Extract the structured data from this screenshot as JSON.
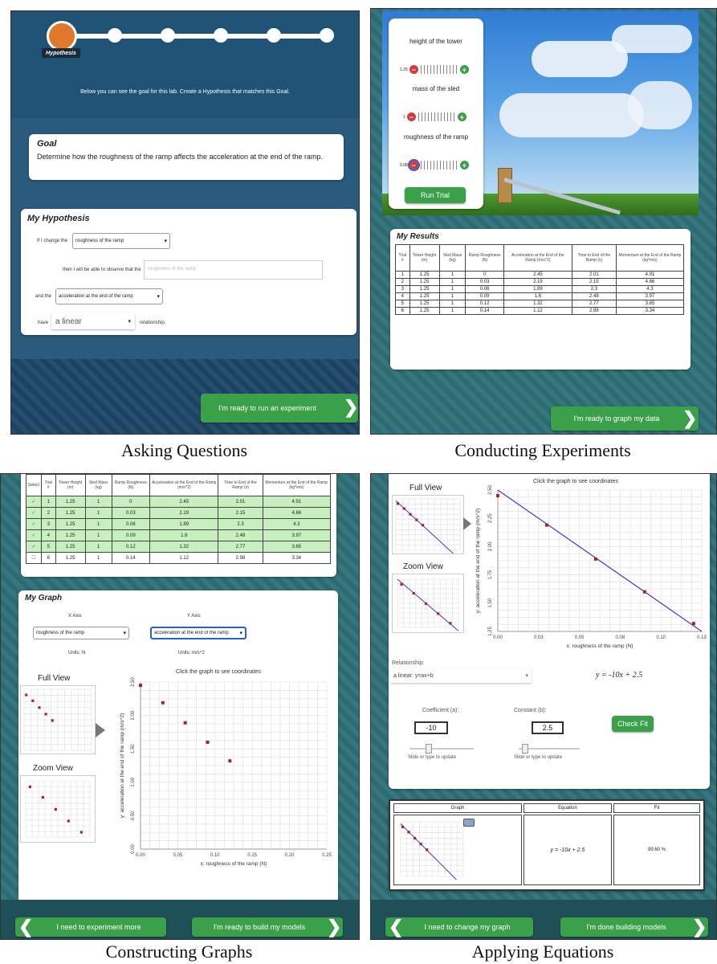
{
  "captions": {
    "q1": "Asking Questions",
    "q2": "Conducting Experiments",
    "q3": "Constructing Graphs",
    "q4": "Applying Equations"
  },
  "colors": {
    "teal": "#2d6f76",
    "navy": "#1e4a6b",
    "green": "#3aa04a",
    "red": "#d63b3b",
    "blue_line": "#3b3bd6",
    "point": "#b02020"
  },
  "asking": {
    "step_label": "Hypothesis",
    "intro": "Below you can see the goal for this lab. Create a Hypothesis that matches this Goal.",
    "goal_title": "Goal",
    "goal_text": "Determine how the roughness of the ramp affects the acceleration at the end of the ramp.",
    "hyp_title": "My Hypothesis",
    "if_change": "If I change the",
    "var1": "roughness of the ramp",
    "then_text": "then I will be able to observe that the",
    "then_placeholder": "roughness of the ramp",
    "and_the": "and the",
    "var2": "acceleration at the end of the ramp",
    "have": "have",
    "relationship": "a linear",
    "relationship_suffix": "relationship.",
    "next_button": "I'm ready to run an experiment"
  },
  "experiment": {
    "controls": [
      {
        "label": "height of the tower",
        "value": "1.25"
      },
      {
        "label": "mass of the sled",
        "value": "1"
      },
      {
        "label": "roughness of the ramp",
        "value": "0.08"
      }
    ],
    "run_button": "Run Trial",
    "results_title": "My Results",
    "headers": [
      "Trial #",
      "Tower Height (m)",
      "Sled Mass (kg)",
      "Ramp Roughness (N)",
      "Acceleration at the End of the Ramp (m/s^2)",
      "Time to End of the Ramp (s)",
      "Momentum at the End of the Ramp (kg*m/s)"
    ],
    "rows": [
      [
        "1",
        "1.25",
        "1",
        "0",
        "2.45",
        "2.01",
        "4.91"
      ],
      [
        "2",
        "1.25",
        "1",
        "0.03",
        "2.19",
        "2.15",
        "4.66"
      ],
      [
        "3",
        "1.25",
        "1",
        "0.06",
        "1.89",
        "2.3",
        "4.3"
      ],
      [
        "4",
        "1.25",
        "1",
        "0.09",
        "1.6",
        "2.48",
        "3.97"
      ],
      [
        "5",
        "1.25",
        "1",
        "0.12",
        "1.32",
        "2.77",
        "3.65"
      ],
      [
        "6",
        "1.25",
        "1",
        "0.14",
        "1.12",
        "2.98",
        "3.34"
      ]
    ],
    "next_button": "I'm ready to graph my data"
  },
  "graphs": {
    "headers": [
      "Select",
      "Trial #",
      "Tower Height (m)",
      "Sled Mass (kg)",
      "Ramp Roughness (N)",
      "Acceleration at the End of the Ramp (m/s^2)",
      "Time to End of the Ramp (s)",
      "Momentum at the End of the Ramp (kg*m/s)"
    ],
    "rows": [
      [
        "✓",
        "1",
        "1.25",
        "1",
        "0",
        "2.45",
        "2.01",
        "4.91"
      ],
      [
        "✓",
        "2",
        "1.25",
        "1",
        "0.03",
        "2.19",
        "2.15",
        "4.66"
      ],
      [
        "✓",
        "3",
        "1.25",
        "1",
        "0.06",
        "1.89",
        "2.3",
        "4.3"
      ],
      [
        "✓",
        "4",
        "1.25",
        "1",
        "0.09",
        "1.6",
        "2.48",
        "3.97"
      ],
      [
        "✓",
        "5",
        "1.25",
        "1",
        "0.12",
        "1.32",
        "2.77",
        "3.65"
      ],
      [
        "☐",
        "6",
        "1.25",
        "1",
        "0.14",
        "1.12",
        "2.98",
        "3.34"
      ]
    ],
    "graph_title": "My Graph",
    "x_axis_label": "X Axis",
    "y_axis_label": "Y Axis",
    "x_select": "roughness of the ramp",
    "y_select": "acceleration at the end of the ramp",
    "x_units": "Units: N",
    "y_units": "Units: m/s^2",
    "click_hint": "Click the graph to see coordinates",
    "full_view": "Full View",
    "zoom_view": "Zoom View",
    "back_button": "I need to experiment more",
    "next_button": "I'm ready to build my models"
  },
  "equations": {
    "full_view": "Full View",
    "zoom_view": "Zoom View",
    "click_hint": "Click the graph to see coordinates",
    "relationship_label": "Relationship:",
    "relationship_value": "a linear: y=ax+b",
    "equation": "y = -10x + 2.5",
    "coef_label": "Coefficient (a):",
    "coef_value": "-10",
    "const_label": "Constant (b):",
    "const_value": "2.5",
    "slider_hint": "Slide or type to update",
    "check_button": "Check Fit",
    "table_headers": [
      "Graph",
      "Equation",
      "Fit"
    ],
    "table_equation": "y = -10x + 2.5",
    "table_fit": "99.60 %",
    "back_button": "I need to change my graph",
    "next_button": "I'm done building models"
  },
  "chart_data": [
    {
      "type": "scatter",
      "title": "Click the graph to see coordinates",
      "xlabel": "x: roughness of the ramp (N)",
      "ylabel": "y: acceleration at the end of the ramp (m/s^2)",
      "x": [
        0,
        0.03,
        0.06,
        0.09,
        0.12
      ],
      "y": [
        2.45,
        2.19,
        1.89,
        1.6,
        1.32
      ],
      "xlim": [
        0,
        0.25
      ],
      "ylim": [
        0,
        2.5
      ],
      "xticks": [
        "0.00",
        "0.05",
        "0.10",
        "0.15",
        "0.20",
        "0.25"
      ],
      "yticks": [
        "0.00",
        "0.50",
        "1.00",
        "1.50",
        "2.00",
        "2.50"
      ],
      "grid": true
    },
    {
      "type": "line",
      "title": "Click the graph to see coordinates",
      "xlabel": "x: roughness of the ramp (N)",
      "ylabel": "y: acceleration at the end of the ramp (m/s^2)",
      "x": [
        0,
        0.03,
        0.06,
        0.09,
        0.12
      ],
      "y": [
        2.45,
        2.19,
        1.89,
        1.6,
        1.32
      ],
      "fit": {
        "a": -10,
        "b": 2.5
      },
      "xlim": [
        0,
        0.125
      ],
      "ylim": [
        1.25,
        2.5
      ],
      "xticks": [
        "0.00",
        "0.03",
        "0.05",
        "0.08",
        "0.10",
        "0.13"
      ],
      "yticks": [
        "1.25",
        "1.50",
        "1.75",
        "2.00",
        "2.25",
        "2.50"
      ],
      "grid": true
    }
  ]
}
